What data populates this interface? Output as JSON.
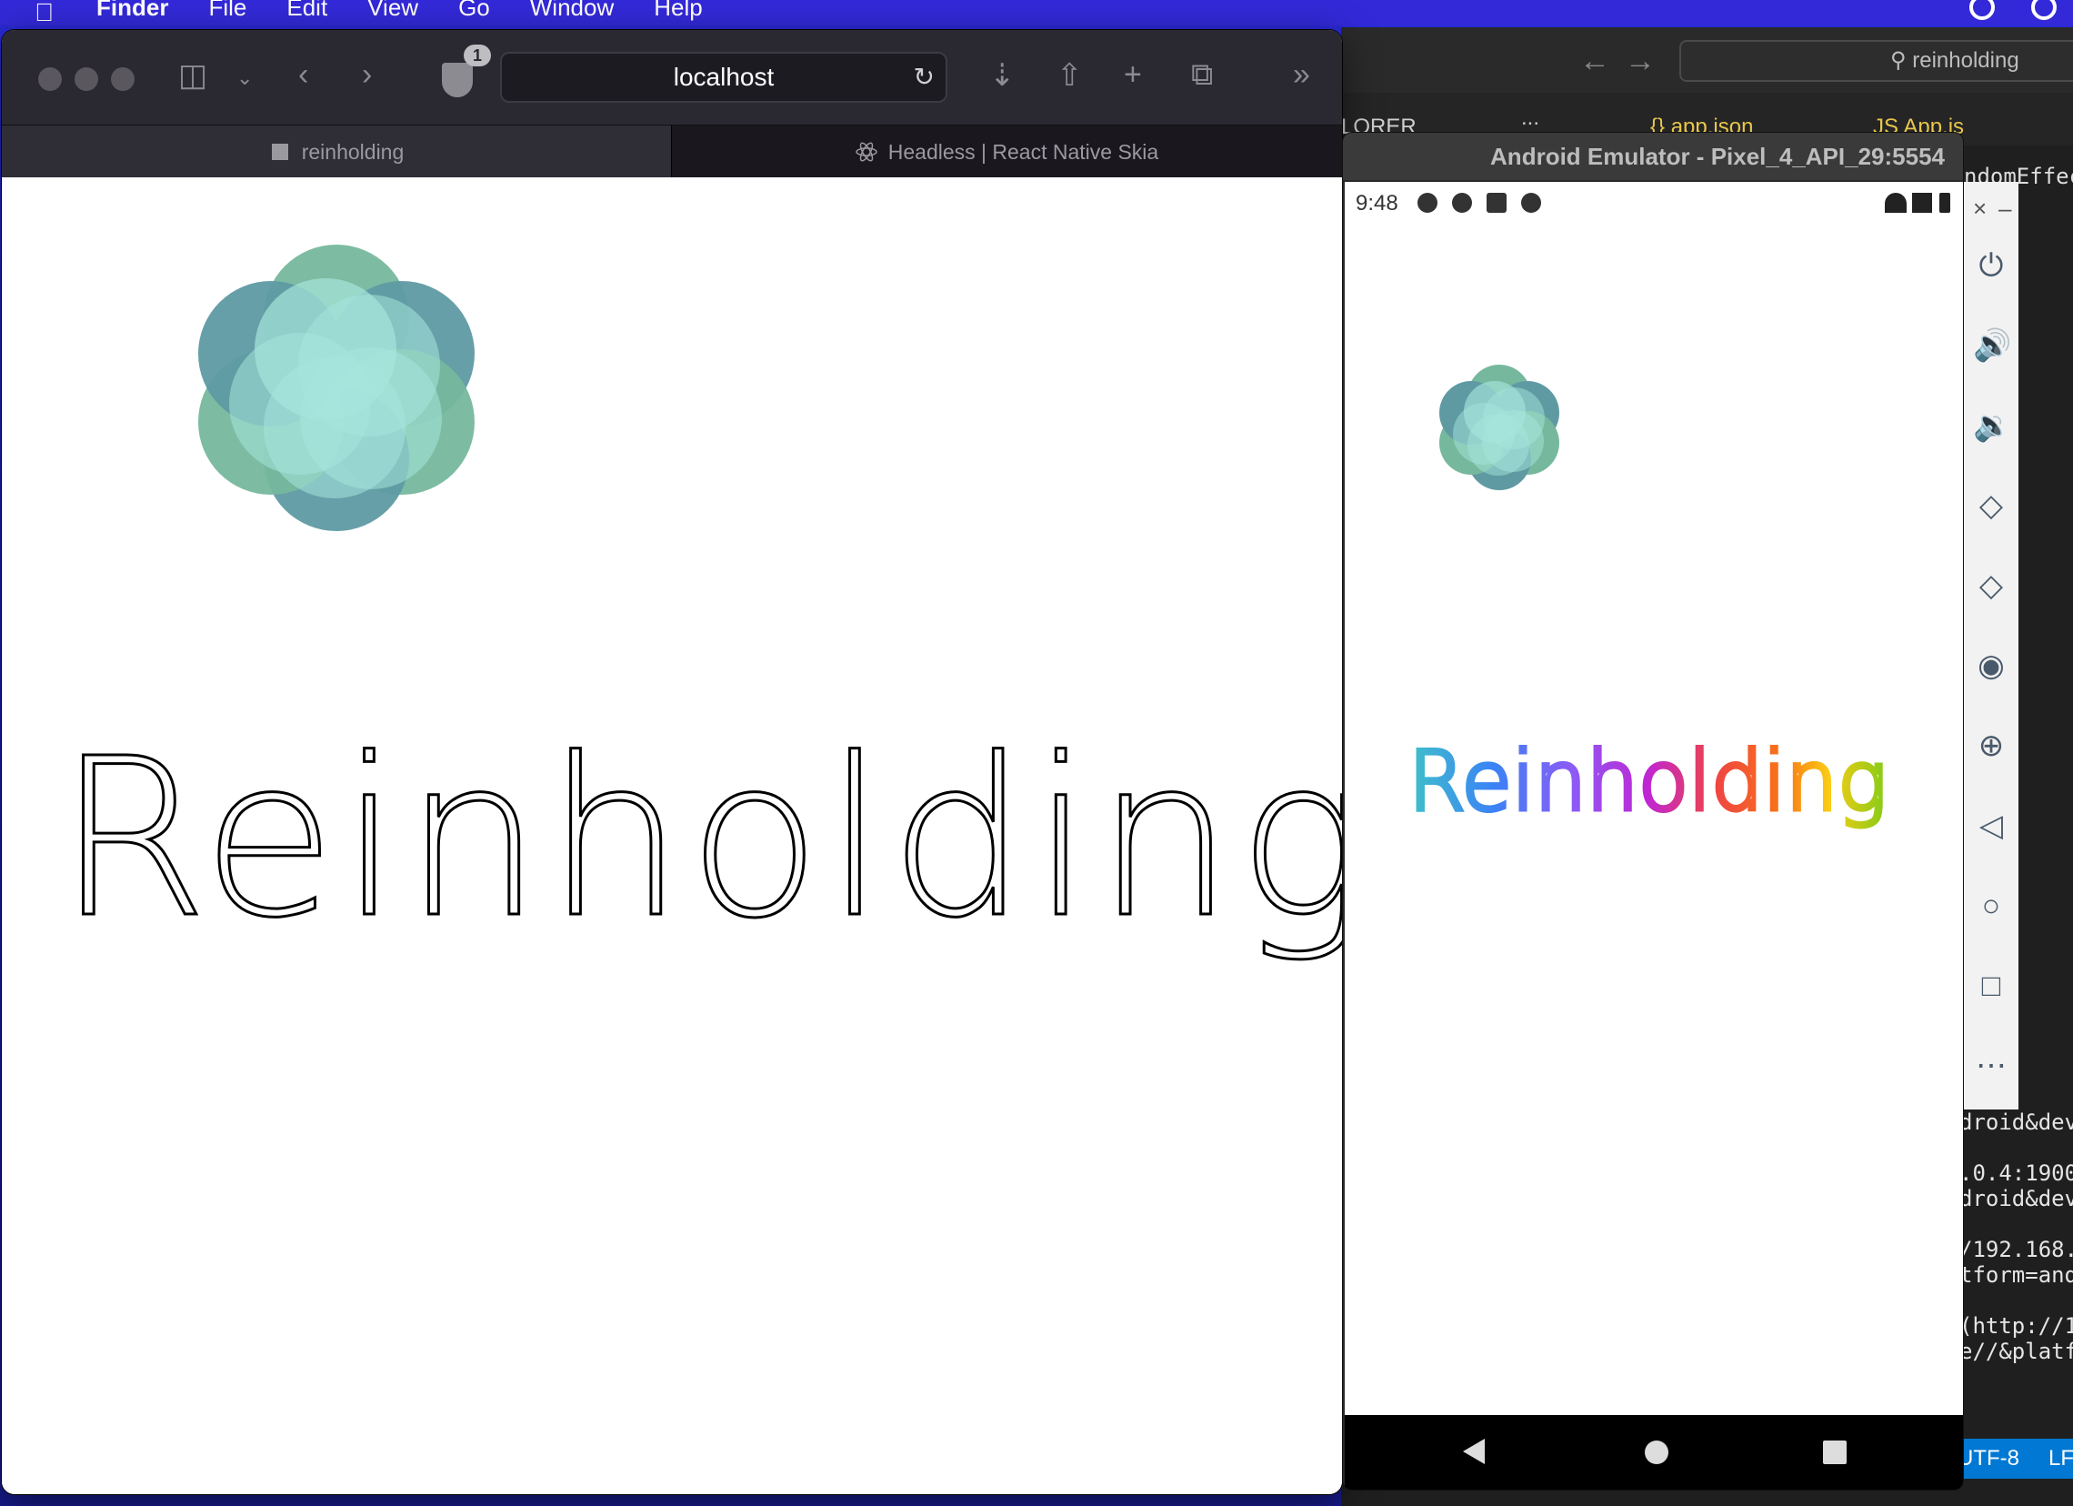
{
  "menubar": {
    "items": [
      "Finder",
      "File",
      "Edit",
      "View",
      "Go",
      "Window",
      "Help"
    ]
  },
  "vscode": {
    "search": "reinholding",
    "tabs": {
      "explorer": "LORER",
      "dots": "...",
      "app_json": "{} app.json",
      "app_js": "JS App.js"
    },
    "side_text": "ndomEffec",
    "terminal": "droid&dev\n\n.0.4:1900\ndroid&dev\n\n/192.168.\ntform=and\n\n(http://1\ne//&platf",
    "status": {
      "encoding": "UTF-8",
      "eol": "LF"
    }
  },
  "safari": {
    "url": "localhost",
    "badge": "1",
    "tabs": [
      {
        "label": "reinholding"
      },
      {
        "label": "Headless | React Native Skia"
      }
    ],
    "content_text": "Reinholding"
  },
  "emulator": {
    "title": "Android Emulator - Pixel_4_API_29:5554",
    "time": "9:48",
    "content_text": "Reinholding",
    "gradient_colors": [
      "#3fc1c9",
      "#3b82f6",
      "#8b5cf6",
      "#c026d3",
      "#ef4444",
      "#f97316",
      "#facc15",
      "#84cc16"
    ],
    "side_controls": [
      "power-icon",
      "volume-up-icon",
      "volume-down-icon",
      "rotate-left-icon",
      "rotate-right-icon",
      "camera-icon",
      "zoom-icon",
      "back-icon",
      "home-icon",
      "overview-icon",
      "more-icon"
    ]
  },
  "colors": {
    "flower_dark": "#5f9aa3",
    "flower_mid": "#76b89d",
    "flower_light": "#a6e5dc"
  }
}
